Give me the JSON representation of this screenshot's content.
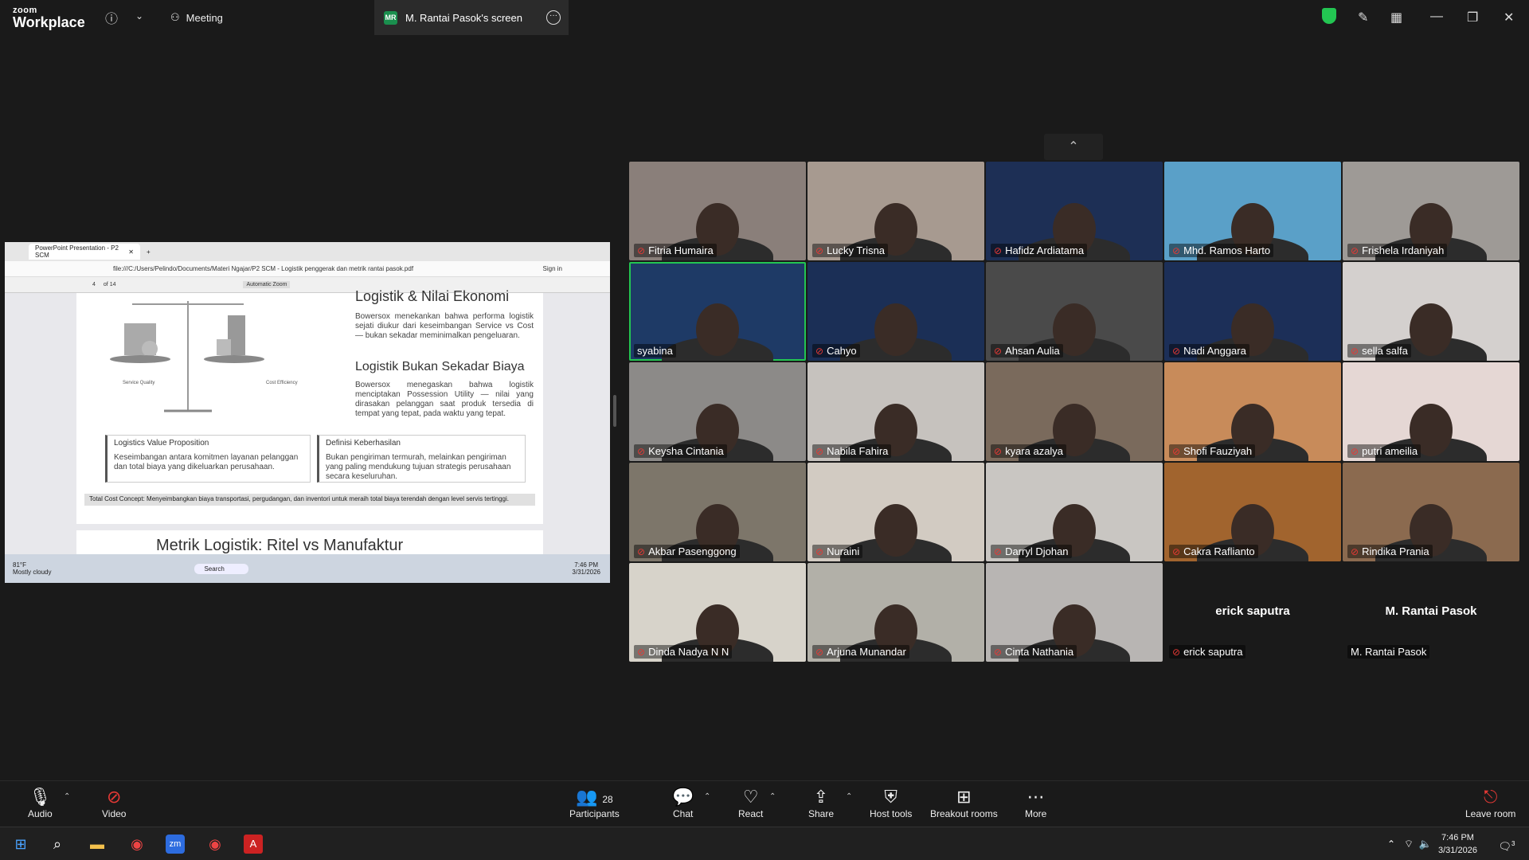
{
  "topbar": {
    "brand_top": "zoom",
    "brand_bottom": "Workplace",
    "meeting_label": "Meeting",
    "screen_badge": "MR",
    "screen_label": "M. Rantai Pasok's screen"
  },
  "shared_screen": {
    "tab_title": "PowerPoint Presentation - P2 SCM",
    "address": "file:///C:/Users/Pelindo/Documents/Materi Ngajar/P2 SCM - Logistik penggerak dan metrik rantai pasok.pdf",
    "sign_in": "Sign in",
    "page_num": "4",
    "page_total": "of 14",
    "zoom": "Automatic Zoom",
    "slide": {
      "title_top": "Logistik & Nilai Ekonomi",
      "para1": "Bowersox menekankan bahwa performa logistik sejati diukur dari keseimbangan Service vs Cost — bukan sekadar meminimalkan pengeluaran.",
      "heading2": "Logistik Bukan Sekadar Biaya",
      "para2": "Bowersox menegaskan bahwa logistik menciptakan Possession Utility — nilai yang dirasakan pelanggan saat produk tersedia di tempat yang tepat, pada waktu yang tepat.",
      "scale_left": "Service Quality",
      "scale_right": "Cost Efficiency",
      "box1_title": "Logistics Value Proposition",
      "box1_text": "Keseimbangan antara komitmen layanan pelanggan dan total biaya yang dikeluarkan perusahaan.",
      "box2_title": "Definisi Keberhasilan",
      "box2_text": "Bukan pengiriman termurah, melainkan pengiriman yang paling mendukung tujuan strategis perusahaan secara keseluruhan.",
      "tcc": "Total Cost Concept: Menyeimbangkan biaya transportasi, pergudangan, dan inventori untuk meraih total biaya terendah dengan level servis tertinggi.",
      "next_title": "Metrik Logistik: Ritel vs Manufaktur"
    },
    "taskbar": {
      "weather_temp": "81°F",
      "weather_desc": "Mostly cloudy",
      "search": "Search",
      "time": "7:46 PM",
      "date": "3/31/2026"
    }
  },
  "participants_grid": [
    {
      "name": "Fitria Humaira",
      "muted": true,
      "bg": "#8a7f7a"
    },
    {
      "name": "Lucky Trisna",
      "muted": true,
      "bg": "#a79a90"
    },
    {
      "name": "Hafidz Ardiatama",
      "muted": true,
      "bg": "#1d2f55"
    },
    {
      "name": "Mhd. Ramos Harto",
      "muted": true,
      "bg": "#5aa0c8"
    },
    {
      "name": "Frishela Irdaniyah",
      "muted": true,
      "bg": "#9e9a96"
    },
    {
      "name": "syabina",
      "muted": false,
      "bg": "#1e3a66",
      "active": true
    },
    {
      "name": "Cahyo",
      "muted": true,
      "bg": "#1b2f56"
    },
    {
      "name": "Ahsan Aulia",
      "muted": true,
      "bg": "#4a4a4a"
    },
    {
      "name": "Nadi Anggara",
      "muted": true,
      "bg": "#1c2f58"
    },
    {
      "name": "sella salfa",
      "muted": true,
      "bg": "#d4d0ce"
    },
    {
      "name": "Keysha Cintania",
      "muted": true,
      "bg": "#8c8a88"
    },
    {
      "name": "Nabila Fahira",
      "muted": true,
      "bg": "#c6c2be"
    },
    {
      "name": "kyara azalya",
      "muted": true,
      "bg": "#7a6a5c"
    },
    {
      "name": "Shofi Fauziyah",
      "muted": true,
      "bg": "#c88b5a"
    },
    {
      "name": "putri ameilia",
      "muted": true,
      "bg": "#e5d7d4"
    },
    {
      "name": "Akbar Pasenggong",
      "muted": true,
      "bg": "#7d766a"
    },
    {
      "name": "Nuraini",
      "muted": true,
      "bg": "#d2cbc2"
    },
    {
      "name": "Darryl Djohan",
      "muted": true,
      "bg": "#c9c6c2"
    },
    {
      "name": "Cakra Raflianto",
      "muted": true,
      "bg": "#a1642e"
    },
    {
      "name": "Rindika Prania",
      "muted": true,
      "bg": "#8b6a4f"
    },
    {
      "name": "Dinda Nadya N N",
      "muted": true,
      "bg": "#d7d3ca"
    },
    {
      "name": "Arjuna Munandar",
      "muted": true,
      "bg": "#b2b0a8"
    },
    {
      "name": "Cinta Nathania",
      "muted": true,
      "bg": "#b8b5b3"
    },
    {
      "name": "erick saputra",
      "muted": true,
      "bg": "#1a1a1a",
      "video_off": true
    },
    {
      "name": "M. Rantai Pasok",
      "muted": false,
      "bg": "#1a1a1a",
      "video_off": true
    }
  ],
  "toolbar": {
    "audio": "Audio",
    "video": "Video",
    "participants": "Participants",
    "participants_count": "28",
    "chat": "Chat",
    "react": "React",
    "share": "Share",
    "host_tools": "Host tools",
    "breakout": "Breakout rooms",
    "more": "More",
    "leave": "Leave room"
  },
  "win_taskbar": {
    "time": "7:46 PM",
    "date": "3/31/2026",
    "notif_count": "3"
  }
}
